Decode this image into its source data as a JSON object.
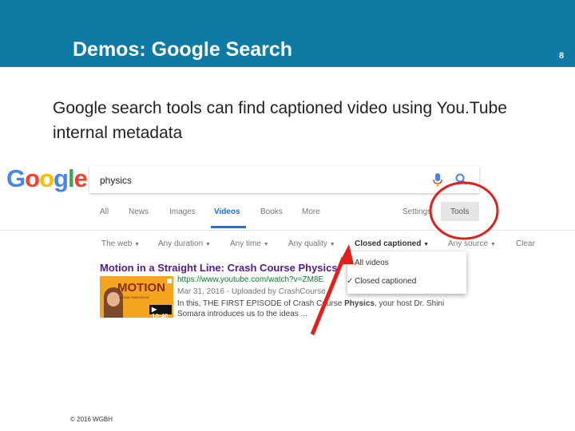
{
  "slide": {
    "title": "Demos: Google Search",
    "page_number": "8",
    "body": "Google search tools can find captioned video using You.Tube internal metadata",
    "footer": "© 2016 WGBH",
    "header_color": "#0f7aa4"
  },
  "google": {
    "logo": [
      "G",
      "o",
      "o",
      "g",
      "l",
      "e"
    ],
    "logo_colors": [
      "#4285f4",
      "#ea4335",
      "#fbbc05",
      "#4285f4",
      "#34a853",
      "#ea4335"
    ],
    "query": "physics",
    "icons": [
      "mic-icon",
      "search-icon"
    ],
    "tabs": [
      "All",
      "News",
      "Images",
      "Videos",
      "Books",
      "More"
    ],
    "active_tab": "Videos",
    "settings": "Settings",
    "tools": "Tools",
    "filters": [
      "The web",
      "Any duration",
      "Any time",
      "Any quality",
      "Closed captioned",
      "Any source",
      "Clear"
    ],
    "selected_filter": "Closed captioned",
    "dropdown": [
      "All videos",
      "Closed captioned"
    ],
    "dropdown_checked": "Closed captioned",
    "result": {
      "title": "Motion in a Straight Line: Crash Course Physics",
      "url": "https://www.youtube.com/watch?v=ZM8E",
      "meta": "Mar 31, 2016 - Uploaded by CrashCourse",
      "desc_prefix": "In this, THE FIRST EPISODE of Crash Course ",
      "desc_bold": "Physics",
      "desc_suffix": ", your host Dr. Shini Somara introduces us to the ideas ...",
      "thumb_title": "MOTION",
      "thumb_subtitle": "IN ONE DIMENSION",
      "duration": "▶ 10:40"
    }
  },
  "annotation": {
    "circle_color": "#e0201b",
    "arrow_color": "#e0201b"
  }
}
